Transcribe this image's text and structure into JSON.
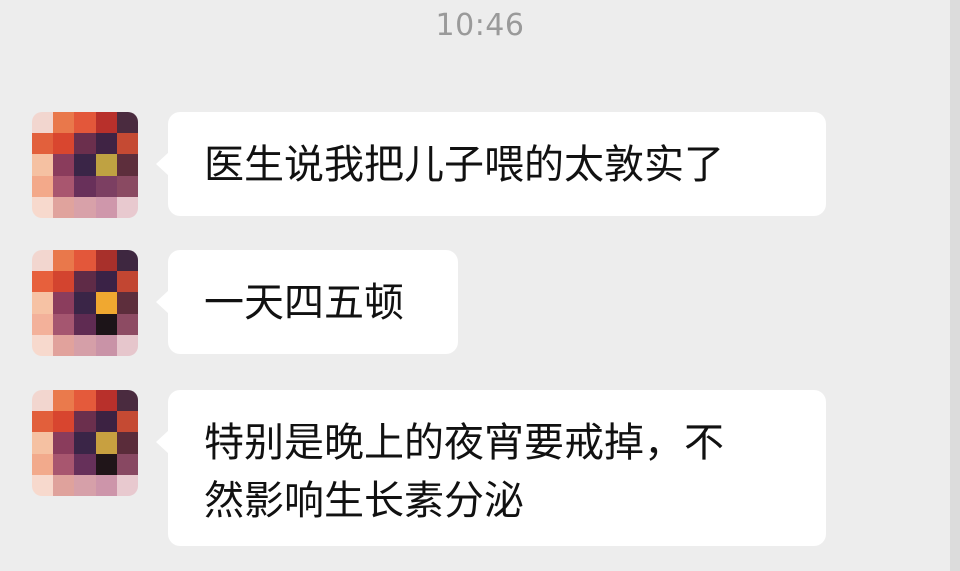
{
  "timestamp": "10:46",
  "messages": [
    {
      "lines": [
        "医生说我把儿子喂的太敦实了"
      ]
    },
    {
      "lines": [
        "一天四五顿"
      ]
    },
    {
      "lines": [
        "特别是晚上的夜宵要戒掉，不",
        "然影响生长素分泌"
      ]
    }
  ],
  "colors": {
    "background": "#ededed",
    "bubble": "#ffffff",
    "text": "#111111",
    "timestamp": "#9a9a9a"
  },
  "icons": {
    "avatar": "pixelated-avatar"
  }
}
